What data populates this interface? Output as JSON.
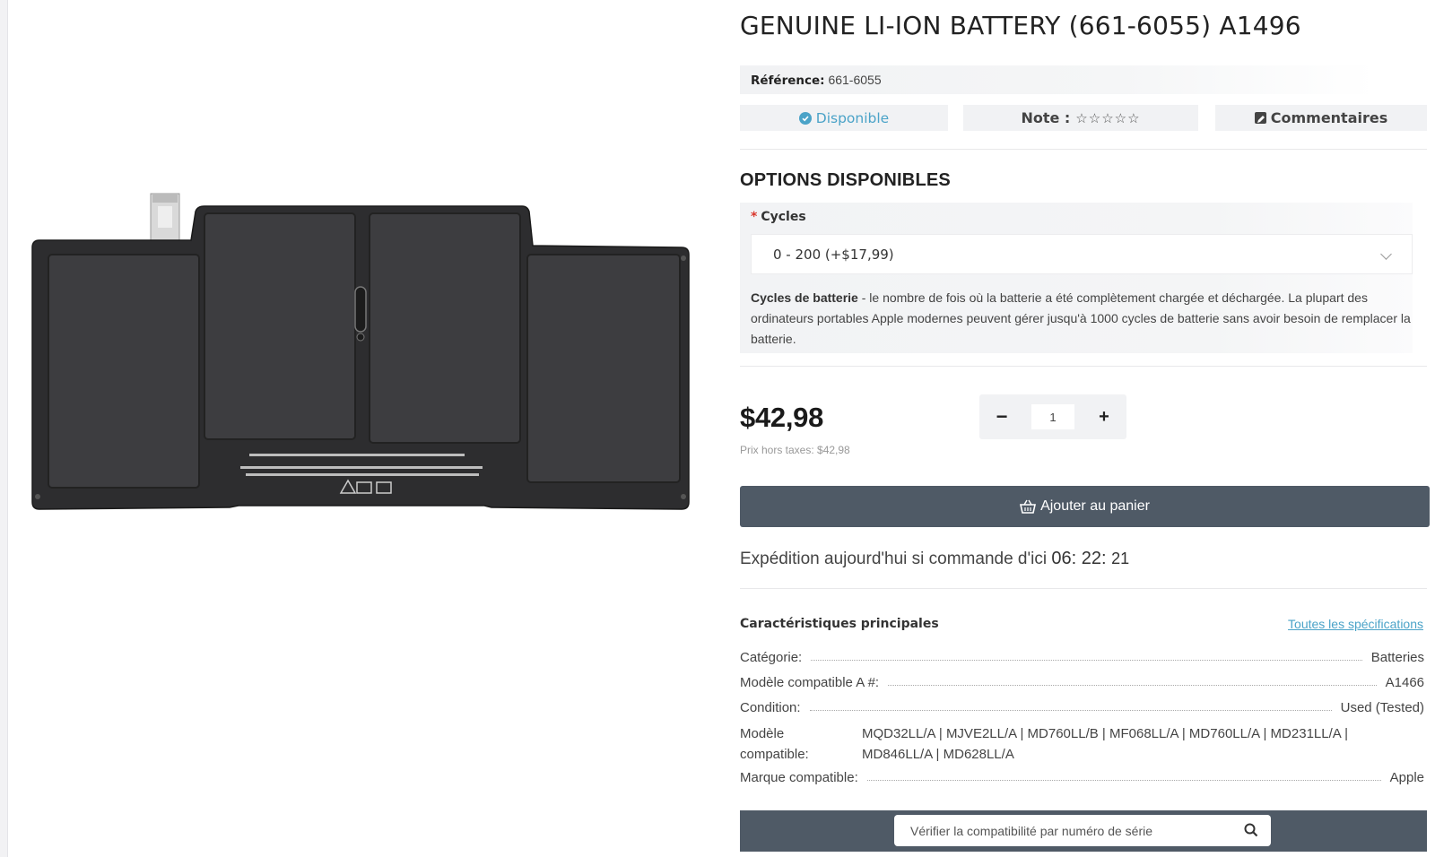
{
  "product": {
    "title": "GENUINE LI-ION BATTERY (661-6055) A1496",
    "reference_label": "Référence:",
    "reference_value": "661-6055",
    "image_alt": "battery-product-image"
  },
  "status": {
    "availability": "Disponible",
    "rating_label": "Note :",
    "rating_stars": "☆☆☆☆☆",
    "rating_value": 0,
    "rating_max": 5,
    "comments_label": "Commentaires"
  },
  "options": {
    "heading": "OPTIONS DISPONIBLES",
    "required_mark": "*",
    "cycles_label": "Cycles",
    "cycles_selected": "0 - 200 (+$17,99)",
    "description_bold": "Cycles de batterie",
    "description_text": " - le nombre de fois où la batterie a été complètement chargée et déchargée. La plupart des ordinateurs portables Apple modernes peuvent gérer jusqu'à 1000 cycles de batterie sans avoir besoin de remplacer la batterie."
  },
  "pricing": {
    "price": "$42,98",
    "price_ht": "Prix hors taxes: $42,98",
    "quantity": "1",
    "minus_label": "−",
    "plus_label": "+"
  },
  "cart": {
    "button_label": "Ajouter au panier"
  },
  "shipping": {
    "text": "Expédition aujourd'hui si commande d'ici ",
    "hours": "06",
    "minutes": "22",
    "seconds": "21"
  },
  "specs": {
    "heading": "Caractéristiques principales",
    "all_specs_link": "Toutes les spécifications",
    "rows": [
      {
        "label": "Catégorie:",
        "value": "Batteries"
      },
      {
        "label": "Modèle compatible A #:",
        "value": "A1466"
      },
      {
        "label": "Condition:",
        "value": "Used (Tested)"
      },
      {
        "label": "Modèle compatible:",
        "value": "MQD32LL/A | MJVE2LL/A | MD760LL/B | MF068LL/A | MD760LL/A | MD231LL/A | MD846LL/A | MD628LL/A"
      },
      {
        "label": "Marque compatible:",
        "value": "Apple"
      }
    ]
  },
  "verify": {
    "placeholder": "Vérifier la compatibilité par numéro de série"
  },
  "colors": {
    "accent": "#4ba3c8",
    "button_bg": "#4f5a66",
    "panel_bg": "#f1f2f4",
    "required": "#d9352b"
  },
  "icons": {
    "availability": "check-circle-icon",
    "comments": "edit-icon",
    "cart": "basket-icon",
    "verify": "search-icon",
    "select": "chevron-down-icon"
  }
}
